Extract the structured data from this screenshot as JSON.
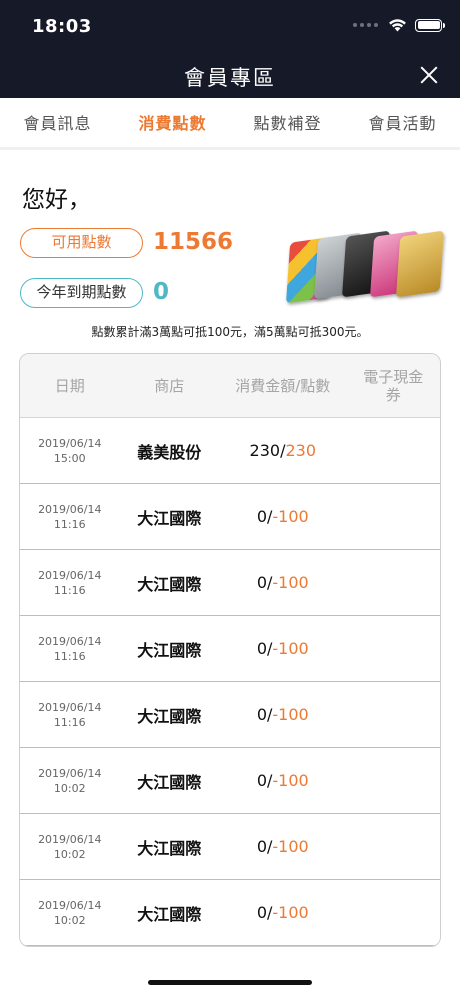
{
  "status": {
    "time": "18:03"
  },
  "nav": {
    "title": "會員專區"
  },
  "tabs": [
    {
      "label": "會員訊息",
      "active": false
    },
    {
      "label": "消費點數",
      "active": true
    },
    {
      "label": "點數補登",
      "active": false
    },
    {
      "label": "會員活動",
      "active": false
    }
  ],
  "greeting": "您好，",
  "points": {
    "available_label": "可用點數",
    "available_value": "11566",
    "expire_label": "今年到期點數",
    "expire_value": "0"
  },
  "note": "點數累計滿3萬點可抵100元，滿5萬點可抵300元。",
  "table": {
    "headers": [
      "日期",
      "商店",
      "消費金額/點數",
      "電子現金券"
    ],
    "rows": [
      {
        "date": "2019/06/14",
        "time": "15:00",
        "store": "義美股份",
        "amount": "230",
        "points": "230",
        "cash": ""
      },
      {
        "date": "2019/06/14",
        "time": "11:16",
        "store": "大江國際",
        "amount": "0",
        "points": "-100",
        "cash": ""
      },
      {
        "date": "2019/06/14",
        "time": "11:16",
        "store": "大江國際",
        "amount": "0",
        "points": "-100",
        "cash": ""
      },
      {
        "date": "2019/06/14",
        "time": "11:16",
        "store": "大江國際",
        "amount": "0",
        "points": "-100",
        "cash": ""
      },
      {
        "date": "2019/06/14",
        "time": "11:16",
        "store": "大江國際",
        "amount": "0",
        "points": "-100",
        "cash": ""
      },
      {
        "date": "2019/06/14",
        "time": "10:02",
        "store": "大江國際",
        "amount": "0",
        "points": "-100",
        "cash": ""
      },
      {
        "date": "2019/06/14",
        "time": "10:02",
        "store": "大江國際",
        "amount": "0",
        "points": "-100",
        "cash": ""
      },
      {
        "date": "2019/06/14",
        "time": "10:02",
        "store": "大江國際",
        "amount": "0",
        "points": "-100",
        "cash": ""
      }
    ]
  },
  "colors": {
    "accent": "#ec7a33",
    "teal": "#4fb8c7",
    "navbar": "#161a28"
  },
  "icons": [
    "wifi-icon",
    "battery-icon",
    "close-icon",
    "member-cards-image"
  ]
}
